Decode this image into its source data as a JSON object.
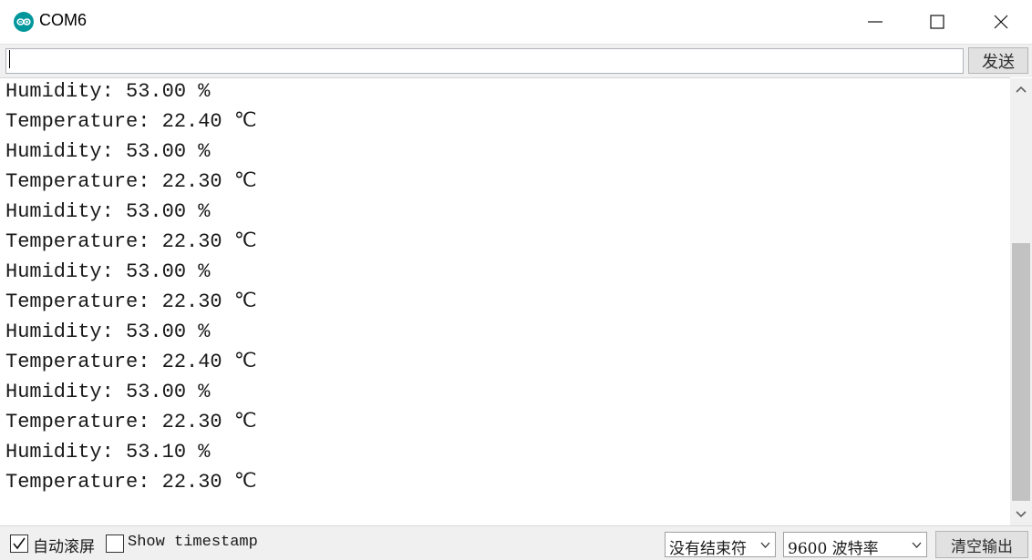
{
  "window": {
    "title": "COM6",
    "icon": "arduino-logo-icon",
    "controls": [
      "minimize-icon",
      "maximize-icon",
      "close-icon"
    ]
  },
  "send_bar": {
    "input_value": "",
    "send_label": "发送"
  },
  "output": {
    "lines": [
      "Humidity: 53.00 %",
      "Temperature: 22.40 ℃",
      "Humidity: 53.00 %",
      "Temperature: 22.30 ℃",
      "Humidity: 53.00 %",
      "Temperature: 22.30 ℃",
      "Humidity: 53.00 %",
      "Temperature: 22.30 ℃",
      "Humidity: 53.00 %",
      "Temperature: 22.40 ℃",
      "Humidity: 53.00 %",
      "Temperature: 22.30 ℃",
      "Humidity: 53.10 %",
      "Temperature: 22.30 ℃"
    ]
  },
  "status_bar": {
    "autoscroll_label": "自动滚屏",
    "autoscroll_checked": true,
    "timestamp_label": "Show timestamp",
    "timestamp_checked": false,
    "line_ending_selected": "没有结束符",
    "baud_selected": "9600 波特率",
    "clear_label": "清空输出"
  },
  "colors": {
    "icon_accent": "#00979c",
    "chrome_background": "#f0f0f0",
    "scroll_thumb": "#c2c2c2"
  }
}
